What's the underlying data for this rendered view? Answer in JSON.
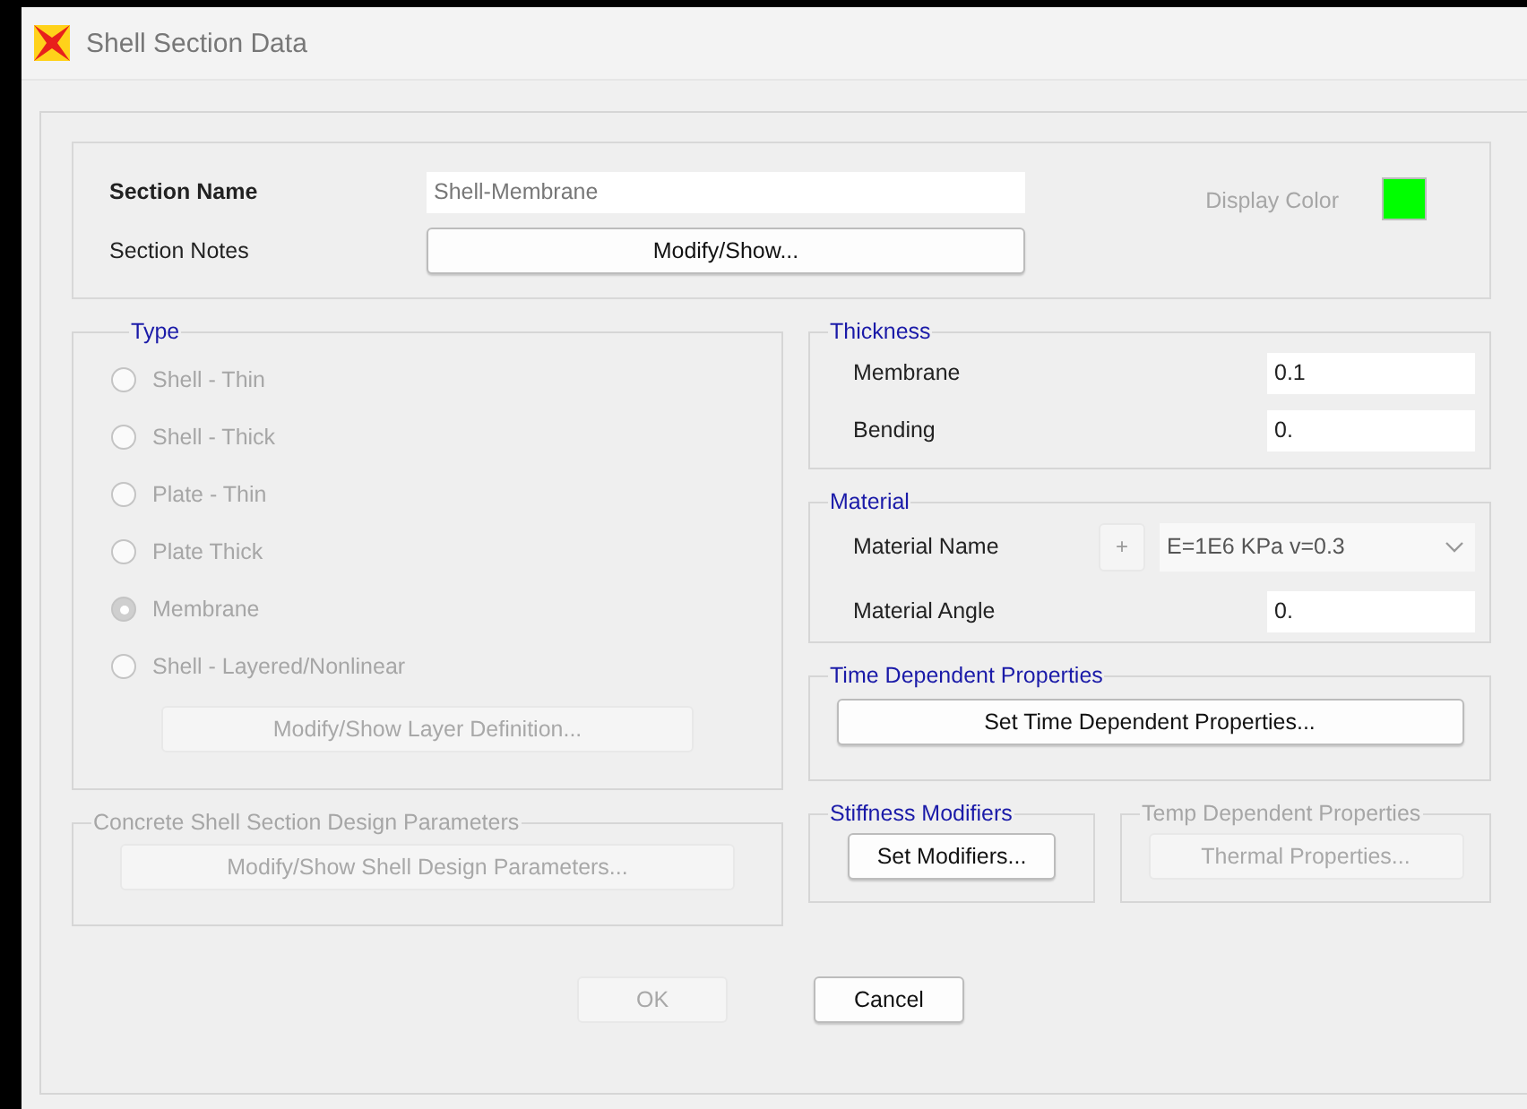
{
  "window": {
    "title": "Shell Section Data"
  },
  "section": {
    "name_label": "Section Name",
    "name_value": "Shell-Membrane",
    "notes_label": "Section Notes",
    "notes_button": "Modify/Show...",
    "display_color": {
      "label": "Display Color",
      "color": "#00ff00"
    }
  },
  "type": {
    "title": "Type",
    "options": [
      {
        "label": "Shell - Thin",
        "selected": false,
        "disabled": true
      },
      {
        "label": "Shell - Thick",
        "selected": false,
        "disabled": true
      },
      {
        "label": "Plate - Thin",
        "selected": false,
        "disabled": true
      },
      {
        "label": "Plate Thick",
        "selected": false,
        "disabled": true
      },
      {
        "label": "Membrane",
        "selected": true,
        "disabled": true
      },
      {
        "label": "Shell - Layered/Nonlinear",
        "selected": false,
        "disabled": true
      }
    ],
    "layer_button": {
      "label": "Modify/Show Layer Definition...",
      "disabled": true
    }
  },
  "concrete_design": {
    "title": "Concrete Shell Section Design Parameters",
    "button": "Modify/Show Shell Design Parameters...",
    "disabled": true
  },
  "thickness": {
    "title": "Thickness",
    "fields": [
      {
        "label": "Membrane",
        "value": "0.1"
      },
      {
        "label": "Bending",
        "value": "0."
      }
    ]
  },
  "material": {
    "title": "Material",
    "name_label": "Material Name",
    "add_button": "+",
    "name_value": "E=1E6 KPa v=0.3",
    "angle_label": "Material Angle",
    "angle_value": "0."
  },
  "time_dependent": {
    "title": "Time Dependent Properties",
    "button": "Set Time Dependent Properties...",
    "disabled": false
  },
  "stiffness_modifiers": {
    "title": "Stiffness Modifiers",
    "button": "Set Modifiers...",
    "disabled": false
  },
  "temp_dependent": {
    "title": "Temp Dependent Properties",
    "button": "Thermal Properties...",
    "disabled": true
  },
  "buttons": [
    {
      "label": "OK",
      "disabled": true
    },
    {
      "label": "Cancel",
      "disabled": false
    }
  ]
}
